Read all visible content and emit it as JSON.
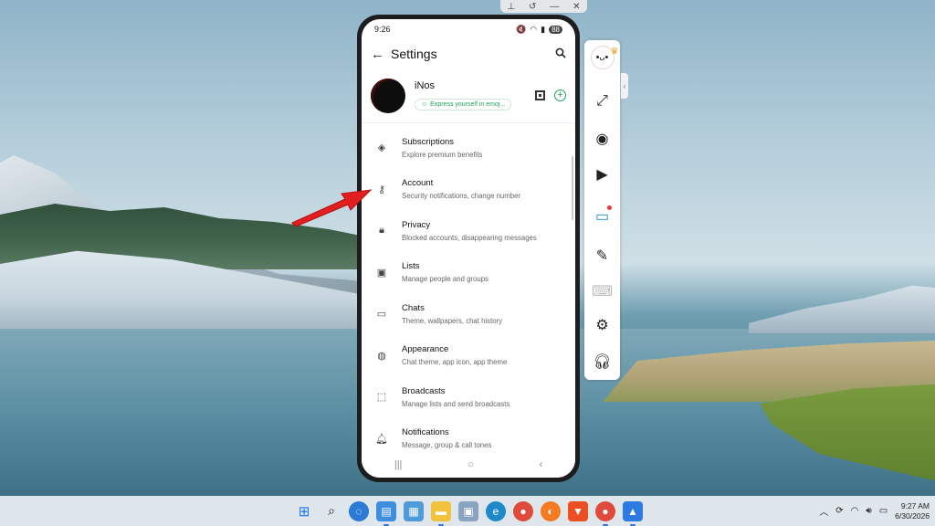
{
  "window": {
    "controls": [
      "pin-icon",
      "history-icon",
      "minimize-icon",
      "close-icon"
    ]
  },
  "phone": {
    "status_bar": {
      "time": "9:26",
      "battery": "88"
    },
    "appbar": {
      "title": "Settings"
    },
    "profile": {
      "name": "iNos",
      "status_placeholder": "Express yourself in emoj..."
    },
    "items": [
      {
        "icon": "diamond-icon",
        "title": "Subscriptions",
        "subtitle": "Explore premium benefits"
      },
      {
        "icon": "key-icon",
        "title": "Account",
        "subtitle": "Security notifications, change number"
      },
      {
        "icon": "lock-icon",
        "title": "Privacy",
        "subtitle": "Blocked accounts, disappearing messages"
      },
      {
        "icon": "contacts-list-icon",
        "title": "Lists",
        "subtitle": "Manage people and groups"
      },
      {
        "icon": "chat-icon",
        "title": "Chats",
        "subtitle": "Theme, wallpapers, chat history"
      },
      {
        "icon": "palette-icon",
        "title": "Appearance",
        "subtitle": "Chat theme, app icon, app theme"
      },
      {
        "icon": "broadcast-icon",
        "title": "Broadcasts",
        "subtitle": "Manage lists and send broadcasts"
      },
      {
        "icon": "bell-icon",
        "title": "Notifications",
        "subtitle": "Message, group & call tones"
      }
    ]
  },
  "side_toolbar": [
    "fullscreen-icon",
    "screenshot-icon",
    "screen-record-icon",
    "cast-icon",
    "brush-icon",
    "keyboard-icon",
    "settings-icon",
    "support-headset-icon"
  ],
  "taskbar": {
    "apps": [
      "start-icon",
      "search-icon",
      "copilot-icon",
      "notepad-icon",
      "app-icon",
      "file-explorer-icon",
      "store-icon",
      "edge-icon",
      "chrome-icon",
      "firefox-icon",
      "brave-icon",
      "chrome-icon",
      "mountain-app-icon"
    ],
    "clock_time": "9:27 AM",
    "clock_date": "6/30/2026"
  },
  "colors": {
    "accent_green": "#1ea35a",
    "annotation_arrow": "#e21f1f"
  }
}
